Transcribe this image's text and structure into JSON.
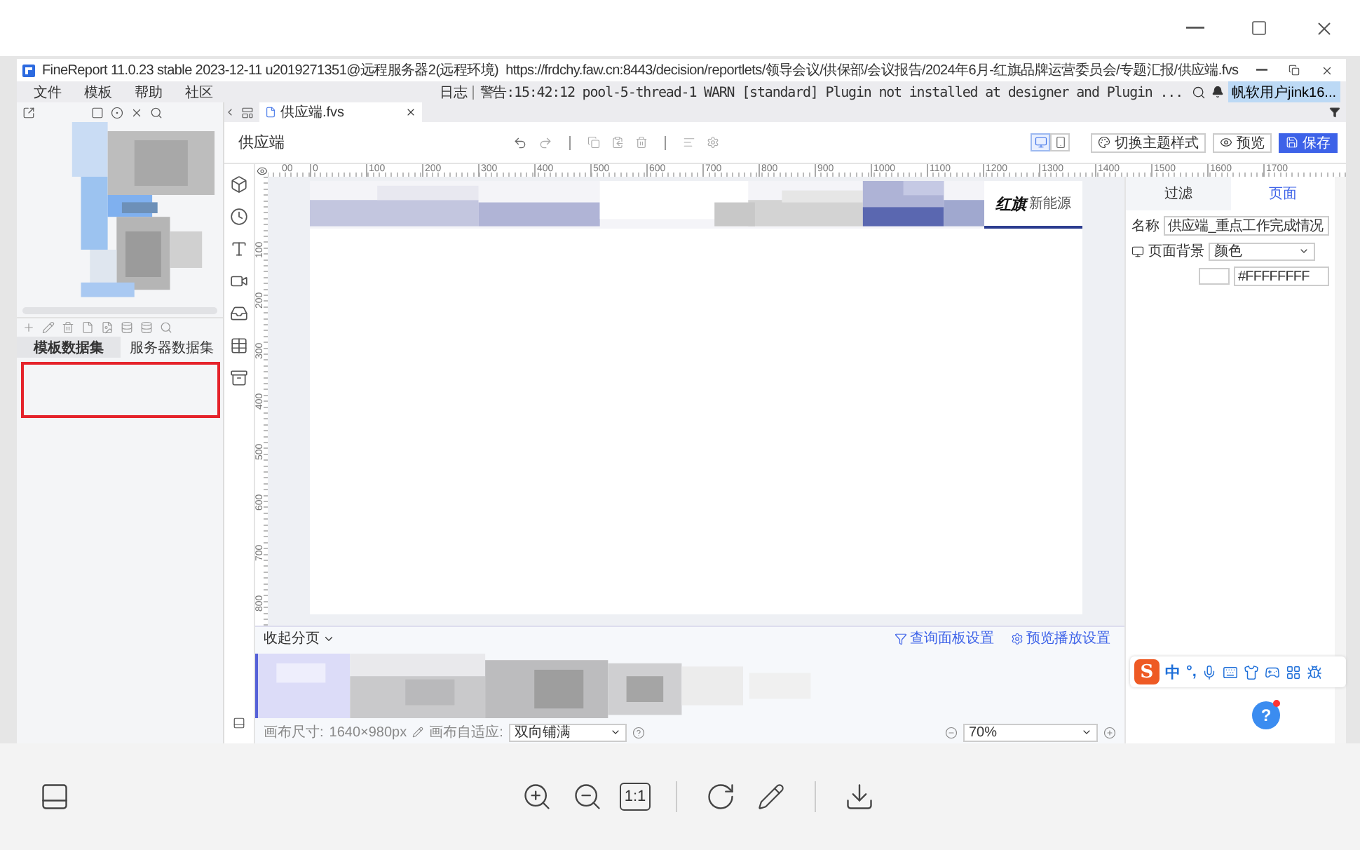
{
  "app": {
    "title": "FineReport 11.0.23 stable 2023-12-11 u2019271351@远程服务器2(远程环境)",
    "url": "https://frdchy.faw.cn:8443/decision/reportlets/领导会议/供保部/会议报告/2024年6月-红旗品牌运营委员会/专题汇报/供应端.fvs"
  },
  "menu": [
    "文件",
    "模板",
    "帮助",
    "社区"
  ],
  "log": {
    "label": "日志",
    "message": "警告:15:42:12 pool-5-thread-1 WARN [standard] Plugin not installed at designer and Plugin ...",
    "user": "帆软用户jink16..."
  },
  "file_tabs": [
    {
      "label": "供应端.fvs",
      "selected": true
    }
  ],
  "dataset_tabs": [
    {
      "label": "模板数据集",
      "selected": true
    },
    {
      "label": "服务器数据集",
      "selected": false
    }
  ],
  "editor": {
    "title": "供应端",
    "view_modes": [
      {
        "kind": "desktop",
        "selected": true
      },
      {
        "kind": "mobile",
        "selected": false
      }
    ],
    "buttons": [
      {
        "kind": "theme",
        "label": "切换主题样式"
      },
      {
        "kind": "preview",
        "label": "预览"
      },
      {
        "kind": "save",
        "label": "保存"
      }
    ]
  },
  "ruler": {
    "x_labels": [
      "00",
      "0",
      "100",
      "200",
      "300",
      "400",
      "500",
      "600",
      "700",
      "800",
      "900",
      "1000",
      "1100",
      "1200",
      "1300",
      "1400",
      "1500",
      "1600",
      "1700"
    ],
    "y_labels": [
      "100",
      "200",
      "300",
      "400",
      "500",
      "600",
      "700",
      "800"
    ]
  },
  "canvas": {
    "logo": "红旗",
    "logo_sub": "新能源"
  },
  "pages_panel": {
    "toggle": "收起分页",
    "links": [
      {
        "kind": "filter",
        "label": "查询面板设置"
      },
      {
        "kind": "settings",
        "label": "预览播放设置"
      }
    ]
  },
  "status": {
    "size_label": "画布尺寸:",
    "size": "1640×980px",
    "fit_label": "画布自适应:",
    "fit": "双向铺满",
    "zoom": "70%"
  },
  "properties": {
    "tabs": [
      {
        "label": "过滤",
        "selected": false
      },
      {
        "label": "页面",
        "selected": true
      }
    ],
    "name_label": "名称",
    "name": "供应端_重点工作完成情况",
    "bg_label": "页面背景",
    "bg_kind": "颜色",
    "bg_value": "#FFFFFFFF"
  },
  "ime": {
    "logo": "S",
    "mode": "中",
    "punct": "°,"
  },
  "help": "?",
  "viewer": {
    "actual_size": "1:1"
  }
}
